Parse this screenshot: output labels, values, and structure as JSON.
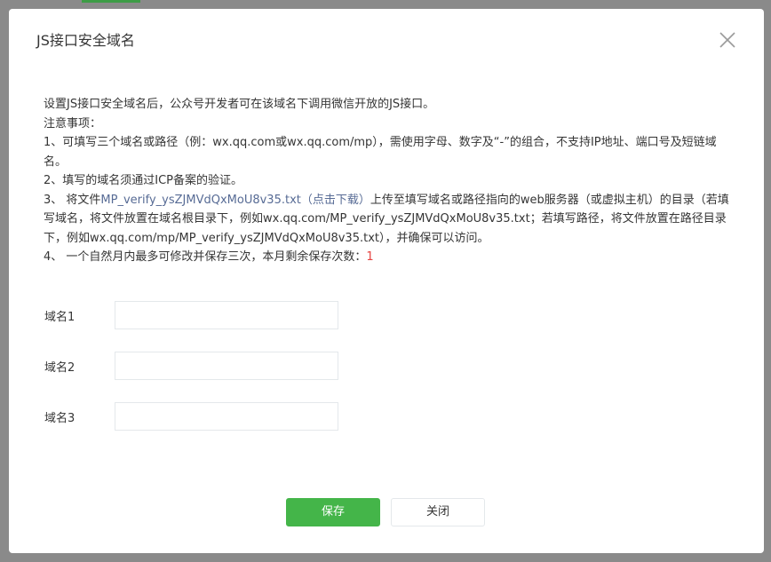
{
  "dialog": {
    "title": "JS接口安全域名",
    "close_icon": "close-icon"
  },
  "notes": {
    "intro": "设置JS接口安全域名后，公众号开发者可在该域名下调用微信开放的JS接口。",
    "heading": "注意事项：",
    "item1": "1、可填写三个域名或路径（例：wx.qq.com或wx.qq.com/mp），需使用字母、数字及“-”的组合，不支持IP地址、端口号及短链域名。",
    "item2": "2、填写的域名须通过ICP备案的验证。",
    "item3_prefix": "3、 将文件",
    "item3_file_link": "MP_verify_ysZJMVdQxMoU8v35.txt",
    "item3_download_link": "（点击下载）",
    "item3_suffix": "上传至填写域名或路径指向的web服务器（或虚拟主机）的目录（若填写域名，将文件放置在域名根目录下，例如wx.qq.com/MP_verify_ysZJMVdQxMoU8v35.txt；若填写路径，将文件放置在路径目录下，例如wx.qq.com/mp/MP_verify_ysZJMVdQxMoU8v35.txt），并确保可以访问。",
    "item4_prefix": "4、 一个自然月内最多可修改并保存三次，本月剩余保存次数：",
    "item4_remaining": "1"
  },
  "form": {
    "fields": [
      {
        "label": "域名1",
        "value": ""
      },
      {
        "label": "域名2",
        "value": ""
      },
      {
        "label": "域名3",
        "value": ""
      }
    ]
  },
  "actions": {
    "save_label": "保存",
    "close_label": "关闭"
  },
  "colors": {
    "primary": "#44b549",
    "link": "#576b95",
    "warning": "#e64340"
  }
}
